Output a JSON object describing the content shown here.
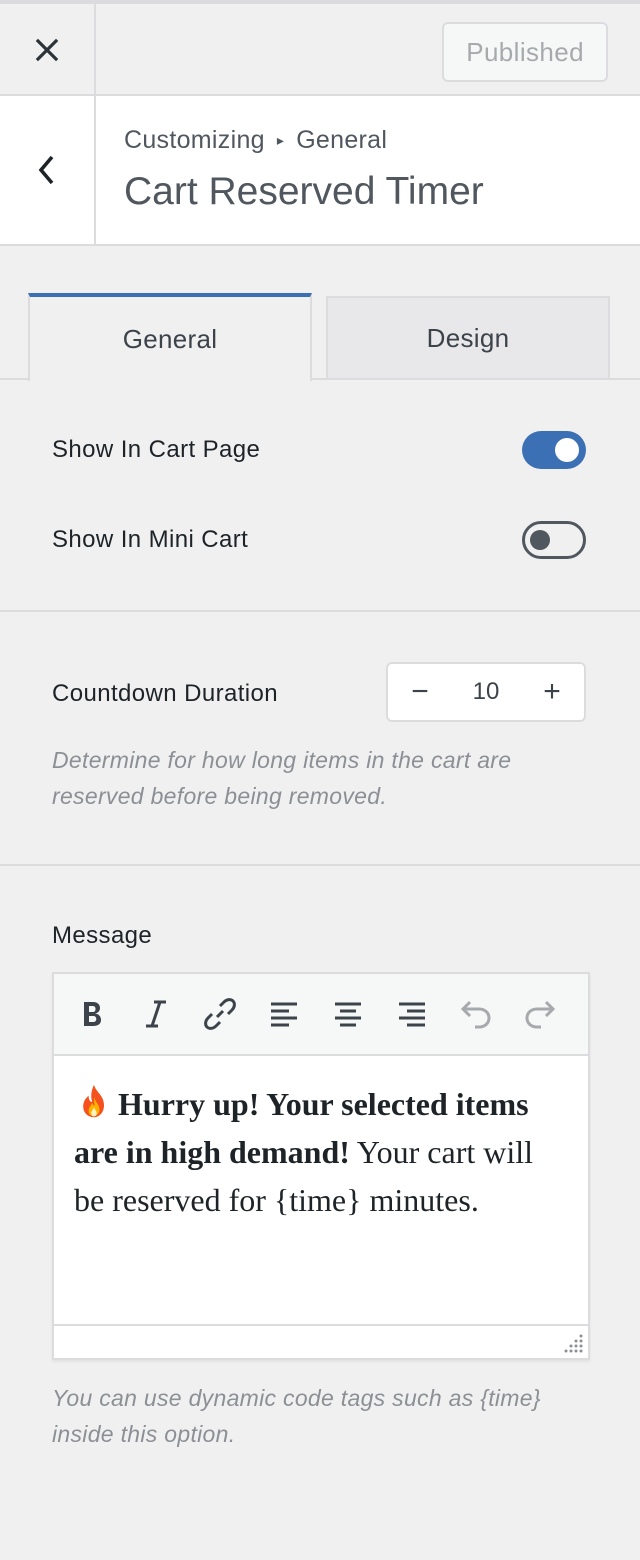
{
  "topbar": {
    "close_icon": "close-icon",
    "published_label": "Published"
  },
  "header": {
    "back_icon": "chevron-left-icon",
    "breadcrumb_root": "Customizing",
    "breadcrumb_separator": "▸",
    "breadcrumb_section": "General",
    "title": "Cart Reserved Timer"
  },
  "tabs": [
    {
      "label": "General",
      "active": true
    },
    {
      "label": "Design",
      "active": false
    }
  ],
  "colors": {
    "accent": "#3c70b5",
    "background": "#f0f0f1",
    "border": "#dcdcde"
  },
  "display_options": {
    "show_in_cart_page": {
      "label": "Show In Cart Page",
      "enabled": true
    },
    "show_in_mini_cart": {
      "label": "Show In Mini Cart",
      "enabled": false
    }
  },
  "countdown": {
    "label": "Countdown Duration",
    "decrement": "−",
    "value": "10",
    "increment": "+",
    "description": "Determine for how long items in the cart are reserved before being removed."
  },
  "message": {
    "label": "Message",
    "toolbar": [
      "bold-icon",
      "italic-icon",
      "link-icon",
      "align-left-icon",
      "align-center-icon",
      "align-right-icon",
      "undo-icon",
      "redo-icon"
    ],
    "emoji": "fire-emoji",
    "bold_text": "Hurry up! Your selected items are in high demand!",
    "body_text": "Your cart will be reserved for {time} minutes.",
    "help": "You can use dynamic code tags such as {time} inside this option."
  }
}
